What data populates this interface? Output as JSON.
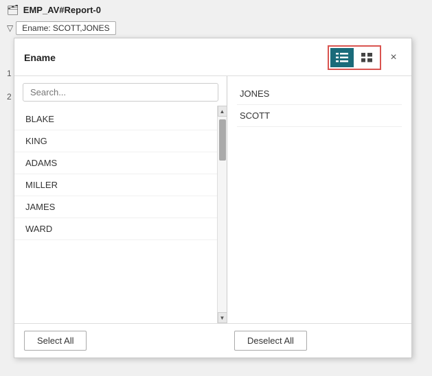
{
  "app": {
    "title": "EMP_AV#Report-0",
    "title_icon": "🗂"
  },
  "filter_bar": {
    "filter_label": "Ename: SCOTT,JONES"
  },
  "dialog": {
    "title": "Ename",
    "close_label": "×",
    "view_list_label": "List View",
    "view_grid_label": "Grid View"
  },
  "search": {
    "placeholder": "Search..."
  },
  "list_items": [
    {
      "id": 1,
      "name": "BLAKE"
    },
    {
      "id": 2,
      "name": "KING"
    },
    {
      "id": 3,
      "name": "ADAMS"
    },
    {
      "id": 4,
      "name": "MILLER"
    },
    {
      "id": 5,
      "name": "JAMES"
    },
    {
      "id": 6,
      "name": "WARD"
    }
  ],
  "selected_items": [
    {
      "name": "JONES"
    },
    {
      "name": "SCOTT"
    }
  ],
  "footer": {
    "select_all": "Select All",
    "deselect_all": "Deselect All"
  },
  "row_numbers": [
    "1",
    "2"
  ]
}
